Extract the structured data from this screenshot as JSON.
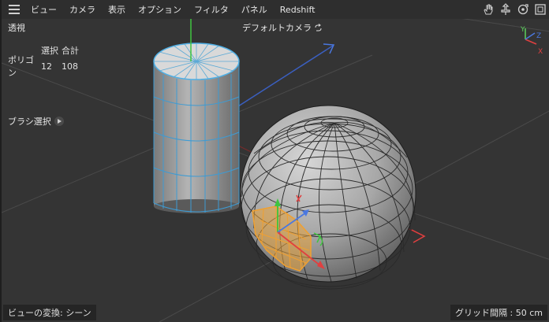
{
  "menubar": {
    "items": [
      "ビュー",
      "カメラ",
      "表示",
      "オプション",
      "フィルタ",
      "パネル",
      "Redshift"
    ],
    "right_icons": [
      "hand-icon",
      "move-icon",
      "rotate-icon",
      "maximize-icon"
    ]
  },
  "viewport": {
    "projection_label": "透視",
    "camera_label": "デフォルトカメラ",
    "camera_icon": "camera-link-icon",
    "stats": {
      "header_selected": "選択",
      "header_total": "合計",
      "row_label": "ポリゴン",
      "selected": "12",
      "total": "108"
    },
    "brush_label": "ブラシ選択",
    "view_transform": "ビューの変換: シーン",
    "grid_spacing": "グリッド間隔 : 50 cm",
    "axes": {
      "x": "X",
      "y": "Y",
      "z": "Z"
    }
  },
  "colors": {
    "background": "#343434",
    "selection_edge": "#4fb0e6",
    "selected_polygons": "#e8a23a",
    "axis_x": "#e04040",
    "axis_y": "#5bd25b",
    "axis_z": "#4a78e0"
  }
}
